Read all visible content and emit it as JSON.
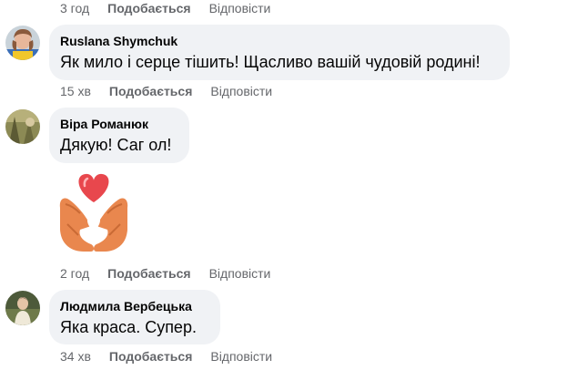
{
  "comments": [
    {
      "time": "3 год",
      "like_label": "Подобається",
      "reply_label": "Відповісти"
    },
    {
      "author": "Ruslana Shymchuk",
      "text": "Як мило і серце тішить! Щасливо вашій чудовій родині!",
      "time": "15 хв",
      "like_label": "Подобається",
      "reply_label": "Відповісти",
      "avatar_icon": "avatar-photo-icon"
    },
    {
      "author": "Віра Романюк",
      "text": "Дякую! Саг ол!",
      "sticker_icon": "heart-hands-sticker-icon",
      "time": "2 год",
      "like_label": "Подобається",
      "reply_label": "Відповісти",
      "avatar_icon": "avatar-photo-icon"
    },
    {
      "author": "Людмила Вербецька",
      "text": "Яка краса. Супер.",
      "time": "34 хв",
      "like_label": "Подобається",
      "reply_label": "Відповісти",
      "avatar_icon": "avatar-photo-icon"
    }
  ],
  "colors": {
    "bubble": "#f0f2f5",
    "meta": "#65676b",
    "text": "#050505",
    "heart": "#e8474d",
    "hands": "#e9874e"
  }
}
